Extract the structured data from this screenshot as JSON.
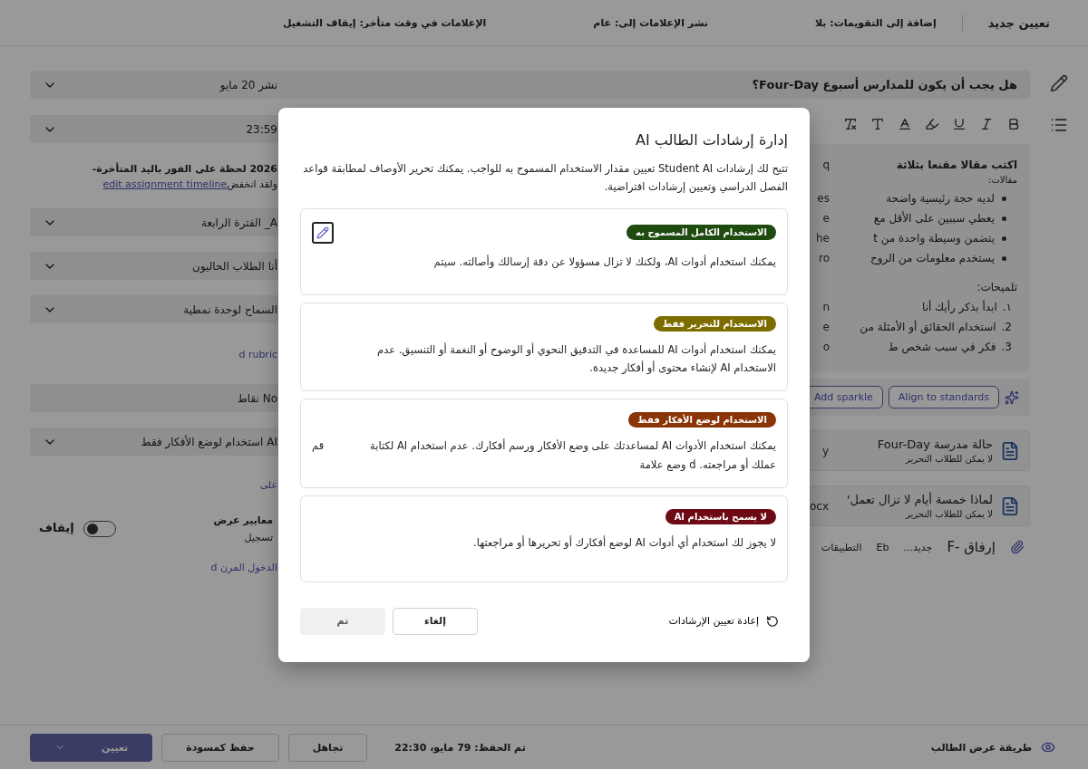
{
  "top_bar": {
    "title": "تعيين جديد",
    "settings": [
      "إضافة إلى التقويمات: بلا",
      "نشر الإعلامات إلى: عام",
      "الإعلامات في وقت متأخر: إيقاف التشغيل"
    ]
  },
  "assignment": {
    "title_value": "هل يجب أن يكون للمدارس أسبوع Four-Day؟",
    "instructions": [
      {
        "kind": "paragraph",
        "text": "اكتب مقالا مقنعا بثلاثة",
        "tail": "q"
      },
      {
        "kind": "label",
        "text": "مقالات:"
      },
      {
        "kind": "bullet",
        "text": "لديه حجة رئيسية واضحة",
        "tail": "es"
      },
      {
        "kind": "bullet",
        "text": "يعطي سببين على الأقل مع",
        "tail": "e"
      },
      {
        "kind": "bullet",
        "text": "يتضمن وسيطة واحدة من t",
        "tail": "he"
      },
      {
        "kind": "bullet",
        "text": "يستخدم معلومات من الروح",
        "tail": "ro"
      },
      {
        "kind": "heading",
        "text": "تلميحات:"
      },
      {
        "kind": "numbered",
        "number": "١.",
        "text": "ابدأ بذكر رأيك أنا",
        "tail": "n"
      },
      {
        "kind": "numbered",
        "number": "2.",
        "text": "استخدام الحقائق أو الأمثلة من",
        "tail": "e"
      },
      {
        "kind": "numbered",
        "number": "3.",
        "text": "فكر في سبب شخص ط",
        "tail": "o"
      }
    ],
    "ai_chips": [
      "Align to standards",
      "Add sparkle"
    ],
    "attachments": [
      {
        "name": "حالة مدرسة Four-Day",
        "tail": "y",
        "note": "لا يمكن للطلاب التحرير"
      },
      {
        "name": "لماذا خمسة أيام لا تزال تعمل'",
        "tail": "ocx",
        "note": "لا يمكن للطلاب التحرير"
      }
    ],
    "attach_actions": [
      "إرفاق -F",
      "جديد...",
      "Eb",
      "التطبيقات"
    ]
  },
  "settings_panel": {
    "publish": "نشر 20 مايو",
    "due_time": "23:59",
    "late_note": "2026 لحظة على الفور باليد المتأخرة-",
    "late_note_2": "ولقد انخفض",
    "timeline_link": "edit assignment timeline",
    "class": "A_ الفترة الرابعة",
    "students": "أنا الطلاب الحاليون",
    "module": "السماح لوحدة نمطية",
    "rubric_link": "d rubric",
    "points": "No نقاط",
    "ai_use": "AI استخدام لوضع الأفكار فقط",
    "link_2": "على",
    "grading": {
      "label": "معايير عرض",
      "label_2": "تسجيل",
      "toggle_label": "إيقاف",
      "on": false
    },
    "flex_link": "الدخول المرن d"
  },
  "bottom_bar": {
    "student_view": "طريقة عرض الطالب",
    "saved": "تم الحفظ: 79 مايو، 22:30",
    "buttons": [
      {
        "label": "تجاهل",
        "kind": "secondary"
      },
      {
        "label": "حفظ كمسودة",
        "kind": "secondary"
      },
      {
        "label": "تعيين",
        "kind": "primary"
      }
    ]
  },
  "dialog": {
    "title": "إدارة إرشادات الطالب AI",
    "description": "تتيح لك إرشادات Student AI تعيين مقدار الاستخدام المسموح به للواجب. يمكنك تحرير الأوصاف لمطابقة قواعد الفصل الدراسي وتعيين إرشادات افتراضية.",
    "levels": [
      {
        "badge": "الاستخدام الكامل المسموح به",
        "color": "#1f4a10",
        "description": "يمكنك استخدام أدوات AI، ولكنك لا تزال مسؤولا عن دقة إرسالك وأصالته. سيتم",
        "editable": true
      },
      {
        "badge": "الاستخدام للتحرير فقط",
        "color": "#7d6d00",
        "description": "يمكنك استخدام أدوات AI للمساعدة في التدقيق النحوي أو الوضوح أو النغمة أو التنسيق. عدم الاستخدام AI لإنشاء محتوى أو أفكار جديدة.",
        "editable": false
      },
      {
        "badge": "الاستخدام لوضع الأفكار فقط",
        "color": "#8a3506",
        "description": "يمكنك استخدام الأدوات AI لمساعدتك على وضع الأفكار ورسم أفكارك. عدم استخدام AI لكتابة عملك أو مراجعته. d وضع علامة",
        "extra": "قم",
        "editable": false
      },
      {
        "badge": "لا يسمح باستخدام AI",
        "color": "#6e0a16",
        "description": "لا يجوز لك استخدام أي أدوات AI لوضع أفكارك أو تحريرها أو مراجعتها.",
        "editable": false
      }
    ],
    "reset": "إعادة تعيين الإرشادات",
    "cancel": "إلغاء",
    "done": {
      "label": "تم",
      "disabled": true
    }
  }
}
